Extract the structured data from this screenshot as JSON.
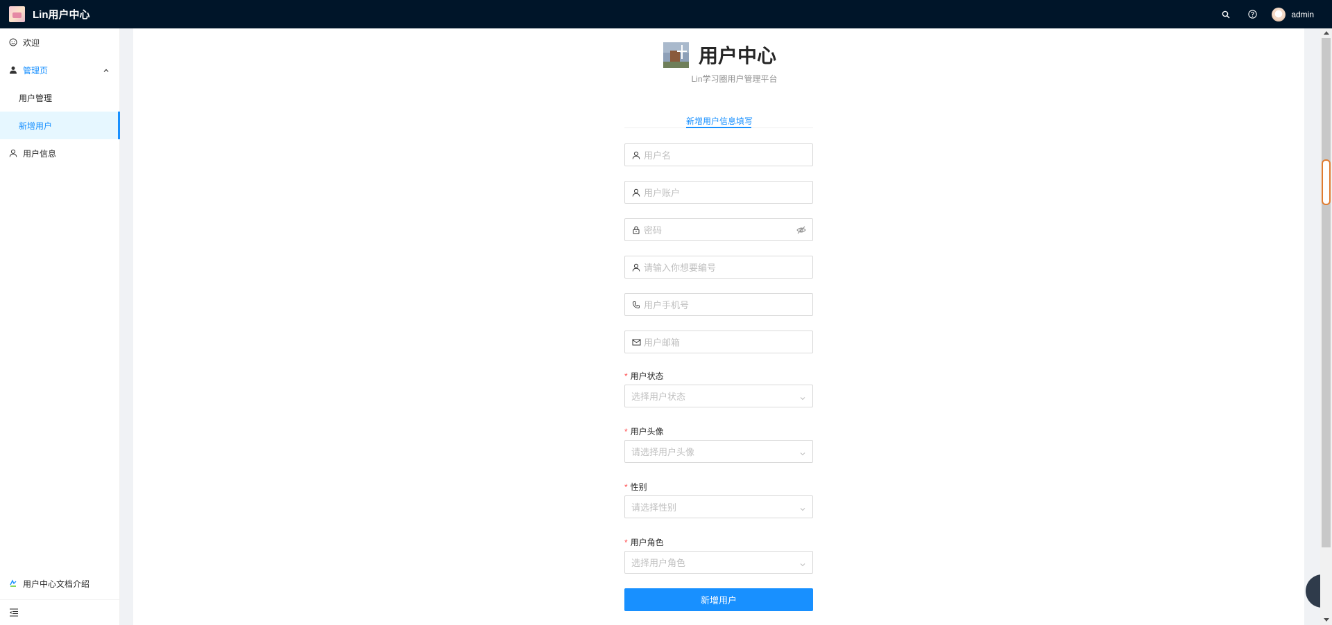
{
  "header": {
    "app_title": "Lin用户中心",
    "username": "admin",
    "icons": [
      "search-icon",
      "question-circle-icon",
      "avatar"
    ]
  },
  "sidebar": {
    "items": [
      {
        "label": "欢迎",
        "icon": "smile-icon"
      },
      {
        "label": "管理页",
        "icon": "crown-user-icon"
      },
      {
        "label": "用户管理"
      },
      {
        "label": "新增用户"
      },
      {
        "label": "用户信息",
        "icon": "user-icon"
      }
    ],
    "footer_link": "用户中心文档介绍",
    "collapse_icon": "menu-fold-icon"
  },
  "brand": {
    "title": "用户中心",
    "subtitle": "Lin学习圈用户管理平台"
  },
  "form": {
    "tab": "新增用户信息填写",
    "fields": [
      {
        "placeholder": "用户名",
        "icon": "user-icon"
      },
      {
        "placeholder": "用户账户",
        "icon": "user-icon"
      },
      {
        "placeholder": "密码",
        "icon": "lock-icon",
        "suffix": "eye-invisible-icon"
      },
      {
        "placeholder": "请输入你想要编号",
        "icon": "user-icon"
      },
      {
        "placeholder": "用户手机号",
        "icon": "phone-icon"
      },
      {
        "placeholder": "用户邮箱",
        "icon": "mail-icon"
      }
    ],
    "selects": [
      {
        "label": "用户状态",
        "placeholder": "选择用户状态"
      },
      {
        "label": "用户头像",
        "placeholder": "请选择用户头像"
      },
      {
        "label": "性别",
        "placeholder": "请选择性别"
      },
      {
        "label": "用户角色",
        "placeholder": "选择用户角色"
      }
    ],
    "submit_label": "新增用户"
  },
  "colors": {
    "header_bg": "#001529",
    "primary": "#1890ff",
    "required": "#ff4d4f"
  }
}
